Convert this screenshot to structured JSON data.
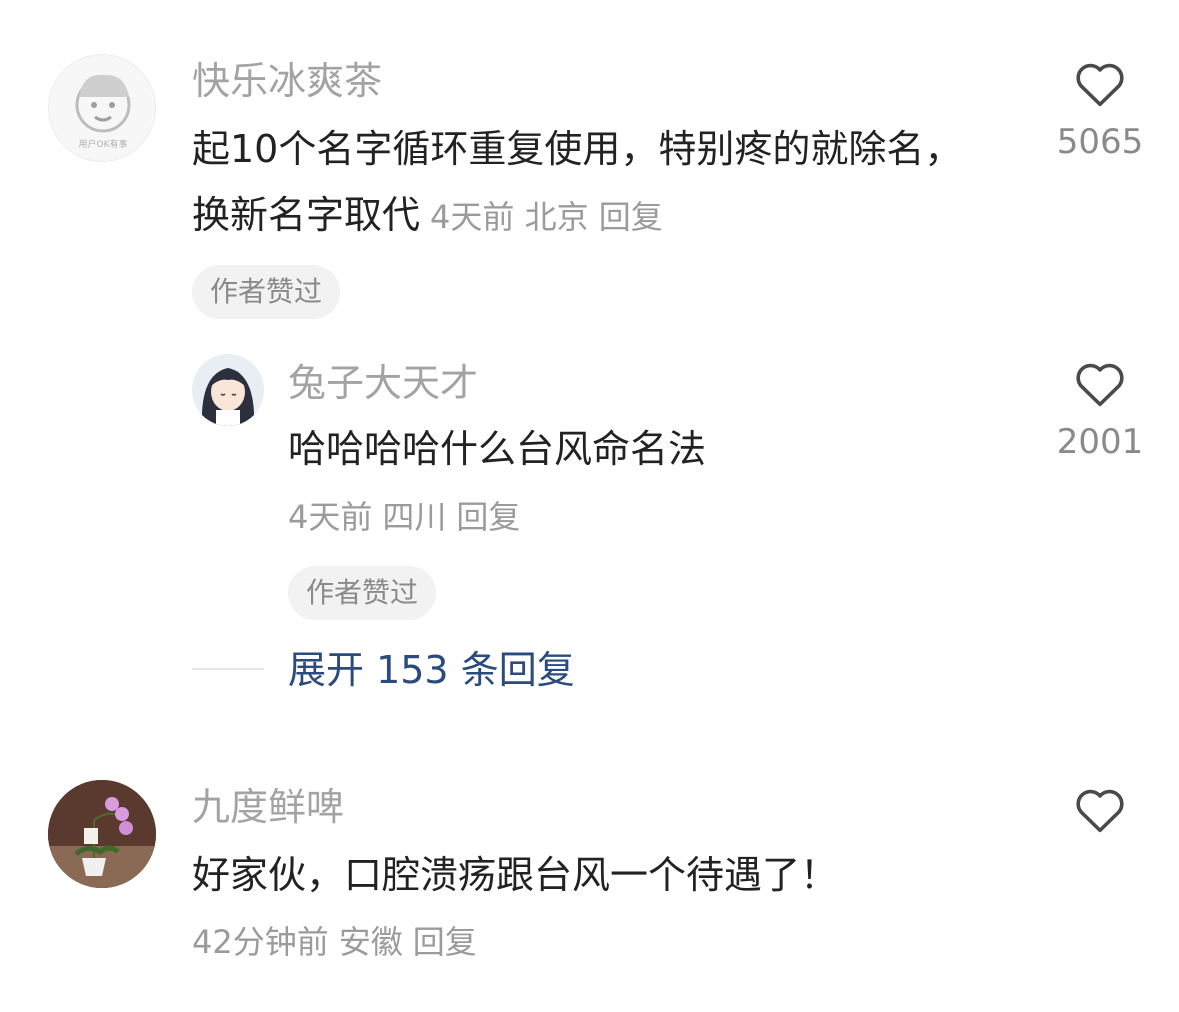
{
  "comments": [
    {
      "username": "快乐冰爽茶",
      "avatar_caption": "用户OK有事",
      "text": "起10个名字循环重复使用，特别疼的就除名，换新名字取代",
      "time": "4天前",
      "location": "北京",
      "reply_label": "回复",
      "badge": "作者赞过",
      "likes": "5065",
      "replies": [
        {
          "username": "兔子大天才",
          "text": "哈哈哈哈什么台风命名法",
          "time": "4天前",
          "location": "四川",
          "reply_label": "回复",
          "badge": "作者赞过",
          "likes": "2001"
        }
      ],
      "expand_label": "展开 153 条回复"
    },
    {
      "username": "九度鲜啤",
      "text": "好家伙，口腔溃疡跟台风一个待遇了！",
      "time": "42分钟前",
      "location": "安徽",
      "reply_label": "回复"
    }
  ],
  "colors": {
    "username": "#a3a3a3",
    "text": "#222222",
    "meta": "#9b9b9b",
    "expand_link": "#2b4a7d",
    "badge_bg": "#f2f2f2"
  },
  "icons": {
    "like": "heart-outline-icon"
  }
}
